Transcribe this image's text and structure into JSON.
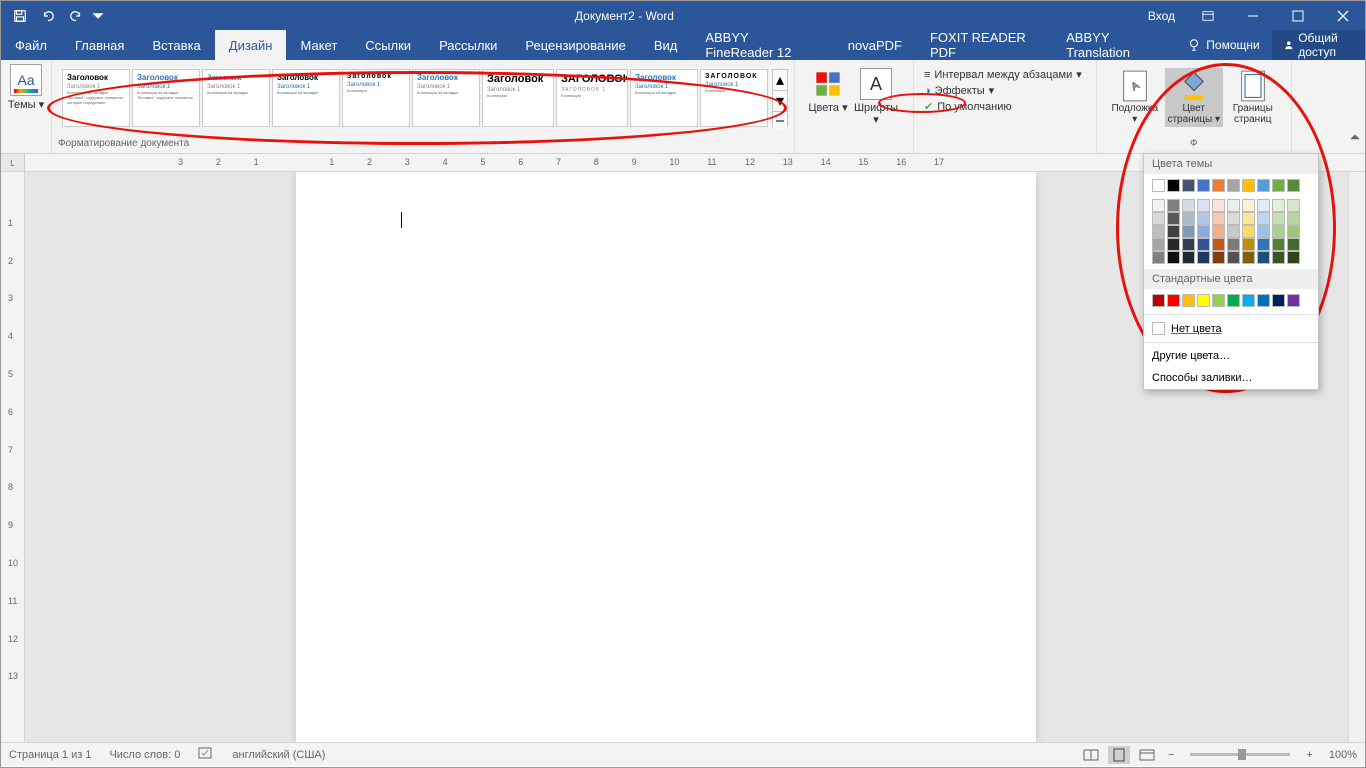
{
  "title": "Документ2 - Word",
  "login": "Вход",
  "tabs": [
    "Файл",
    "Главная",
    "Вставка",
    "Дизайн",
    "Макет",
    "Ссылки",
    "Рассылки",
    "Рецензирование",
    "Вид",
    "ABBYY FineReader 12",
    "novaPDF",
    "FOXIT READER PDF",
    "ABBYY Translation"
  ],
  "active_tab": 3,
  "help": "Помощни",
  "share": "Общий доступ",
  "ribbon": {
    "themes": "Темы",
    "formatting_group": "Форматирование документа",
    "gallery_heading": "Заголовок",
    "gallery_heading_caps": "ЗАГОЛОВОК",
    "gallery_sub": "Заголовок 1",
    "colors": "Цвета",
    "fonts": "Шрифты",
    "spacing": "Интервал между абзацами",
    "effects": "Эффекты",
    "default": "По умолчанию",
    "watermark": "Подложка",
    "page_color": "Цвет страницы",
    "page_borders": "Границы страниц",
    "bg_group": "Фон страницы"
  },
  "dropdown": {
    "theme_colors": "Цвета темы",
    "standard_colors": "Стандартные цвета",
    "no_color": "Нет цвета",
    "more_colors": "Другие цвета…",
    "fill_effects": "Способы заливки…",
    "theme_row1": [
      "#ffffff",
      "#000000",
      "#44546a",
      "#4472c4",
      "#ed7d31",
      "#a5a5a5",
      "#ffc000",
      "#5b9bd5",
      "#70ad47",
      "#588a3a"
    ],
    "shades": [
      [
        "#f2f2f2",
        "#7f7f7f",
        "#d6dce5",
        "#d9e1f2",
        "#fce4d6",
        "#ededed",
        "#fff2cc",
        "#ddebf7",
        "#e2efda",
        "#d6e6cc"
      ],
      [
        "#d9d9d9",
        "#595959",
        "#adb9ca",
        "#b4c6e7",
        "#f8cbad",
        "#dbdbdb",
        "#ffe699",
        "#bdd7ee",
        "#c6e0b4",
        "#b8d6a4"
      ],
      [
        "#bfbfbf",
        "#404040",
        "#8497b0",
        "#8ea9db",
        "#f4b084",
        "#c9c9c9",
        "#ffd966",
        "#9bc2e6",
        "#a9d08e",
        "#9bc67c"
      ],
      [
        "#a6a6a6",
        "#262626",
        "#333f4f",
        "#305496",
        "#c65911",
        "#7b7b7b",
        "#bf8f00",
        "#2f75b5",
        "#548235",
        "#456c2a"
      ],
      [
        "#808080",
        "#0d0d0d",
        "#222b35",
        "#203764",
        "#833c0c",
        "#525252",
        "#806000",
        "#1f4e78",
        "#375623",
        "#2c451c"
      ]
    ],
    "standard": [
      "#c00000",
      "#ff0000",
      "#ffc000",
      "#ffff00",
      "#92d050",
      "#00b050",
      "#00b0f0",
      "#0070c0",
      "#002060",
      "#7030a0"
    ]
  },
  "ruler_marks": [
    "3",
    "2",
    "1",
    "",
    "1",
    "2",
    "3",
    "4",
    "5",
    "6",
    "7",
    "8",
    "9",
    "10",
    "11",
    "12",
    "13",
    "14",
    "15",
    "16",
    "17"
  ],
  "vruler": [
    "",
    "1",
    "2",
    "3",
    "4",
    "5",
    "6",
    "7",
    "8",
    "9",
    "10",
    "11",
    "12",
    "13"
  ],
  "status": {
    "page": "Страница 1 из 1",
    "words": "Число слов: 0",
    "lang": "английский (США)",
    "zoom": "100%"
  }
}
